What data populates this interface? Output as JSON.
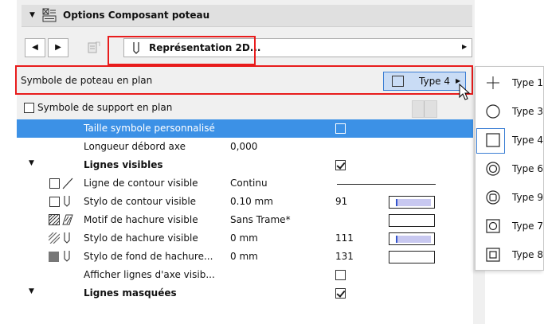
{
  "panel": {
    "title": "Options Composant poteau",
    "nav": {
      "prev": "◀",
      "next": "▶"
    },
    "page_selector": "Représentation 2D...",
    "symbol_label": "Symbole de poteau en plan",
    "symbol_value": "Type 4",
    "support_label": "Symbole de support en plan"
  },
  "params": [
    {
      "label": "Taille symbole personnalisé",
      "value": "",
      "extra": "",
      "selected": true
    },
    {
      "label": "Longueur débord axe",
      "value": "0,000",
      "extra": ""
    },
    {
      "label": "Lignes visibles",
      "value": "",
      "extra": ""
    },
    {
      "label": "Ligne de contour visible",
      "value": "Continu",
      "extra": ""
    },
    {
      "label": "Stylo de contour visible",
      "value": "0.10 mm",
      "extra": "91"
    },
    {
      "label": "Motif de hachure visible",
      "value": "Sans Trame*",
      "extra": ""
    },
    {
      "label": "Stylo de hachure visible",
      "value": "0 mm",
      "extra": "111"
    },
    {
      "label": "Stylo de fond de hachure...",
      "value": "0 mm",
      "extra": "131"
    },
    {
      "label": "Afficher lignes d'axe visib...",
      "value": "",
      "extra": ""
    },
    {
      "label": "Lignes masquées",
      "value": "",
      "extra": ""
    }
  ],
  "dropdown": [
    {
      "label": "Type 1",
      "icon": "cross-symbol-icon"
    },
    {
      "label": "Type 3",
      "icon": "circle-symbol-icon"
    },
    {
      "label": "Type 4",
      "icon": "square-symbol-icon"
    },
    {
      "label": "Type 6",
      "icon": "double-circle-symbol-icon"
    },
    {
      "label": "Type 9",
      "icon": "circle-in-square-symbol-icon"
    },
    {
      "label": "Type 7",
      "icon": "circle-in-square-symbol-icon"
    },
    {
      "label": "Type 8",
      "icon": "square-in-square-symbol-icon"
    }
  ],
  "colors": {
    "highlight": "#3c91e6",
    "red_frame": "#e81c1c",
    "symbol_field": "#c9dcf5"
  }
}
